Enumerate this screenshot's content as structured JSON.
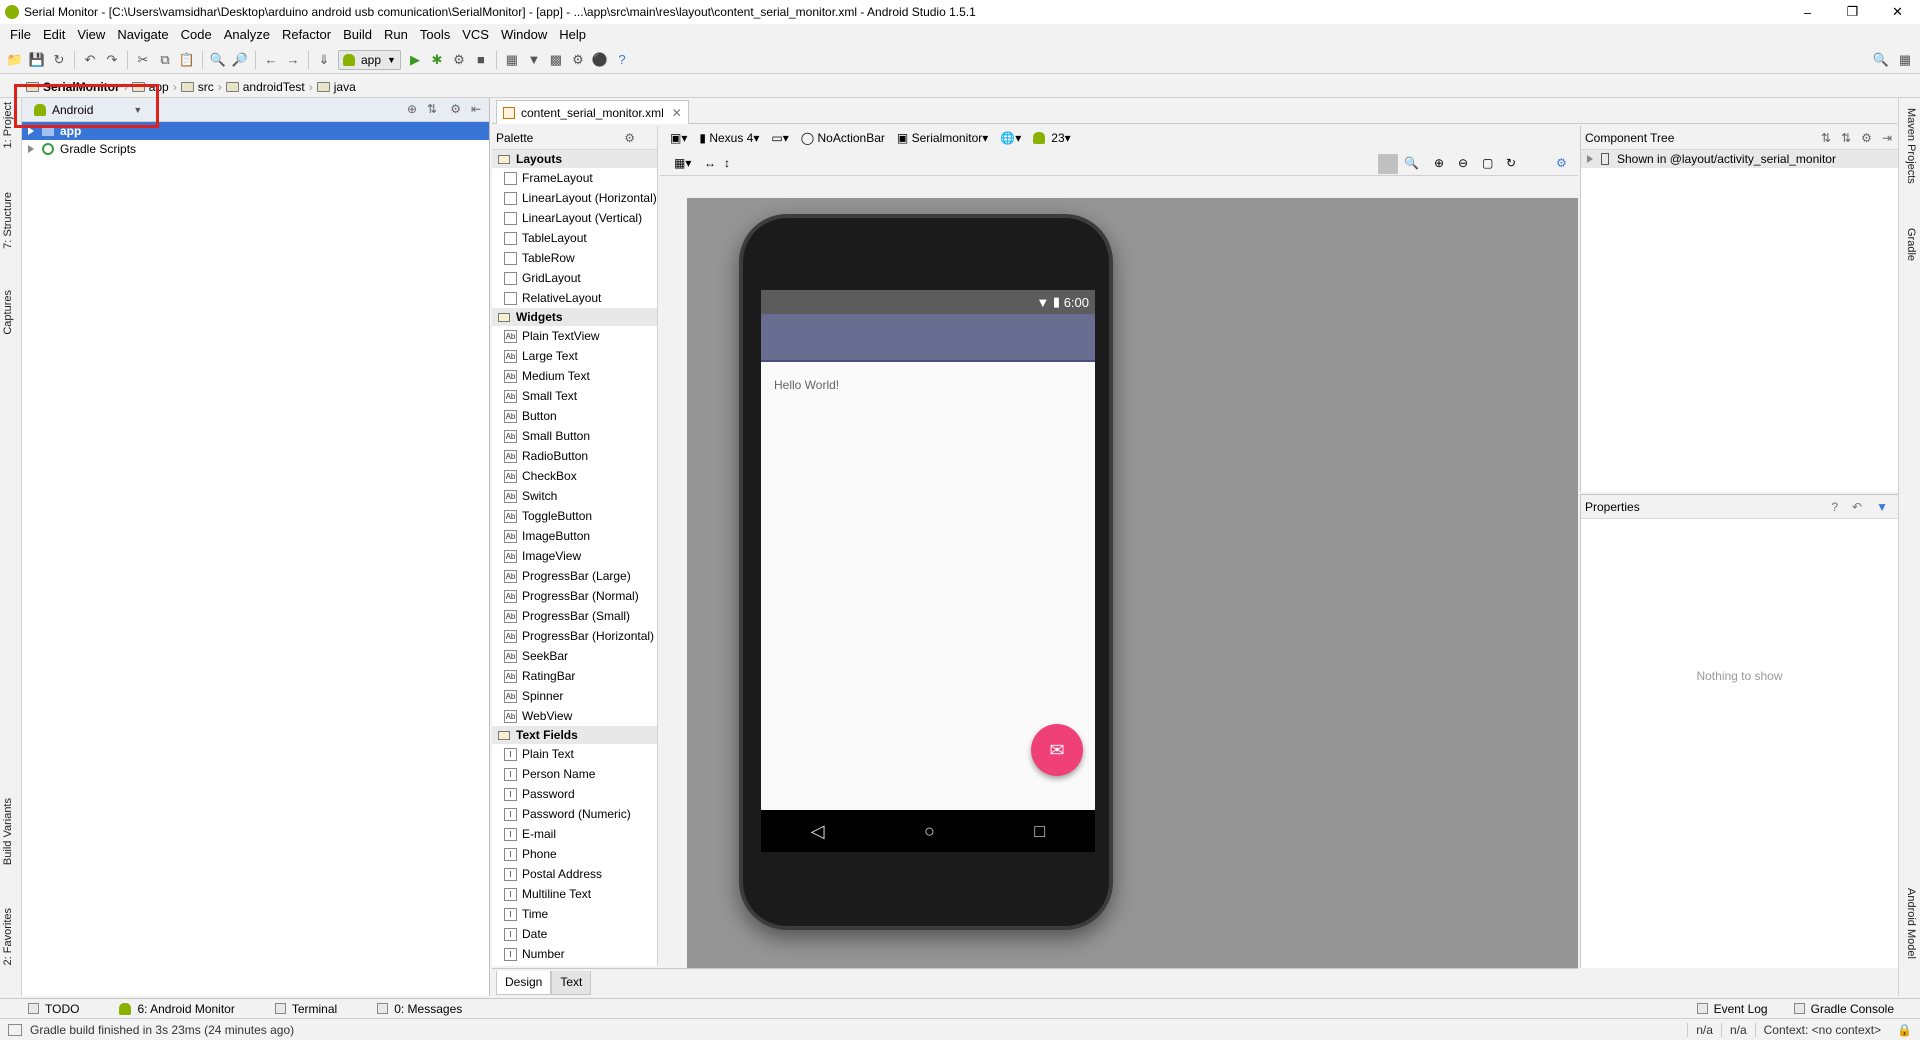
{
  "window": {
    "title": "Serial Monitor - [C:\\Users\\vamsidhar\\Desktop\\arduino android usb comunication\\SerialMonitor] - [app] - ...\\app\\src\\main\\res\\layout\\content_serial_monitor.xml - Android Studio 1.5.1"
  },
  "menu": [
    "File",
    "Edit",
    "View",
    "Navigate",
    "Code",
    "Analyze",
    "Refactor",
    "Build",
    "Run",
    "Tools",
    "VCS",
    "Window",
    "Help"
  ],
  "toolbar": {
    "run_config": "app"
  },
  "breadcrumbs": [
    "SerialMonitor",
    "app",
    "src",
    "androidTest",
    "java"
  ],
  "left_tabs": [
    "1: Project",
    "7: Structure",
    "Captures",
    "Build Variants",
    "2: Favorites"
  ],
  "right_tabs": [
    "Maven Projects",
    "Gradle",
    "Android Model"
  ],
  "project": {
    "view_selector": "Android",
    "tree": [
      {
        "label": "app",
        "selected": true
      },
      {
        "label": "Gradle Scripts",
        "selected": false
      }
    ]
  },
  "editor": {
    "tab": "content_serial_monitor.xml"
  },
  "palette": {
    "title": "Palette",
    "categories": [
      {
        "name": "Layouts",
        "items": [
          "FrameLayout",
          "LinearLayout (Horizontal)",
          "LinearLayout (Vertical)",
          "TableLayout",
          "TableRow",
          "GridLayout",
          "RelativeLayout"
        ]
      },
      {
        "name": "Widgets",
        "items": [
          "Plain TextView",
          "Large Text",
          "Medium Text",
          "Small Text",
          "Button",
          "Small Button",
          "RadioButton",
          "CheckBox",
          "Switch",
          "ToggleButton",
          "ImageButton",
          "ImageView",
          "ProgressBar (Large)",
          "ProgressBar (Normal)",
          "ProgressBar (Small)",
          "ProgressBar (Horizontal)",
          "SeekBar",
          "RatingBar",
          "Spinner",
          "WebView"
        ]
      },
      {
        "name": "Text Fields",
        "items": [
          "Plain Text",
          "Person Name",
          "Password",
          "Password (Numeric)",
          "E-mail",
          "Phone",
          "Postal Address",
          "Multiline Text",
          "Time",
          "Date",
          "Number"
        ]
      }
    ]
  },
  "layout_toolbar": {
    "device": "Nexus 4",
    "theme": "NoActionBar",
    "activity": "Serialmonitor",
    "api": "23"
  },
  "preview": {
    "time": "6:00",
    "hello": "Hello World!"
  },
  "design_tabs": [
    "Design",
    "Text"
  ],
  "component_tree": {
    "title": "Component Tree",
    "row": "Shown in @layout/activity_serial_monitor"
  },
  "properties": {
    "title": "Properties",
    "empty": "Nothing to show"
  },
  "bottom_tabs": {
    "todo": "TODO",
    "monitor": "6: Android Monitor",
    "terminal": "Terminal",
    "messages": "0: Messages",
    "event_log": "Event Log",
    "gradle_console": "Gradle Console"
  },
  "status": {
    "message": "Gradle build finished in 3s 23ms (24 minutes ago)",
    "na1": "n/a",
    "na2": "n/a",
    "context": "Context: <no context>"
  }
}
